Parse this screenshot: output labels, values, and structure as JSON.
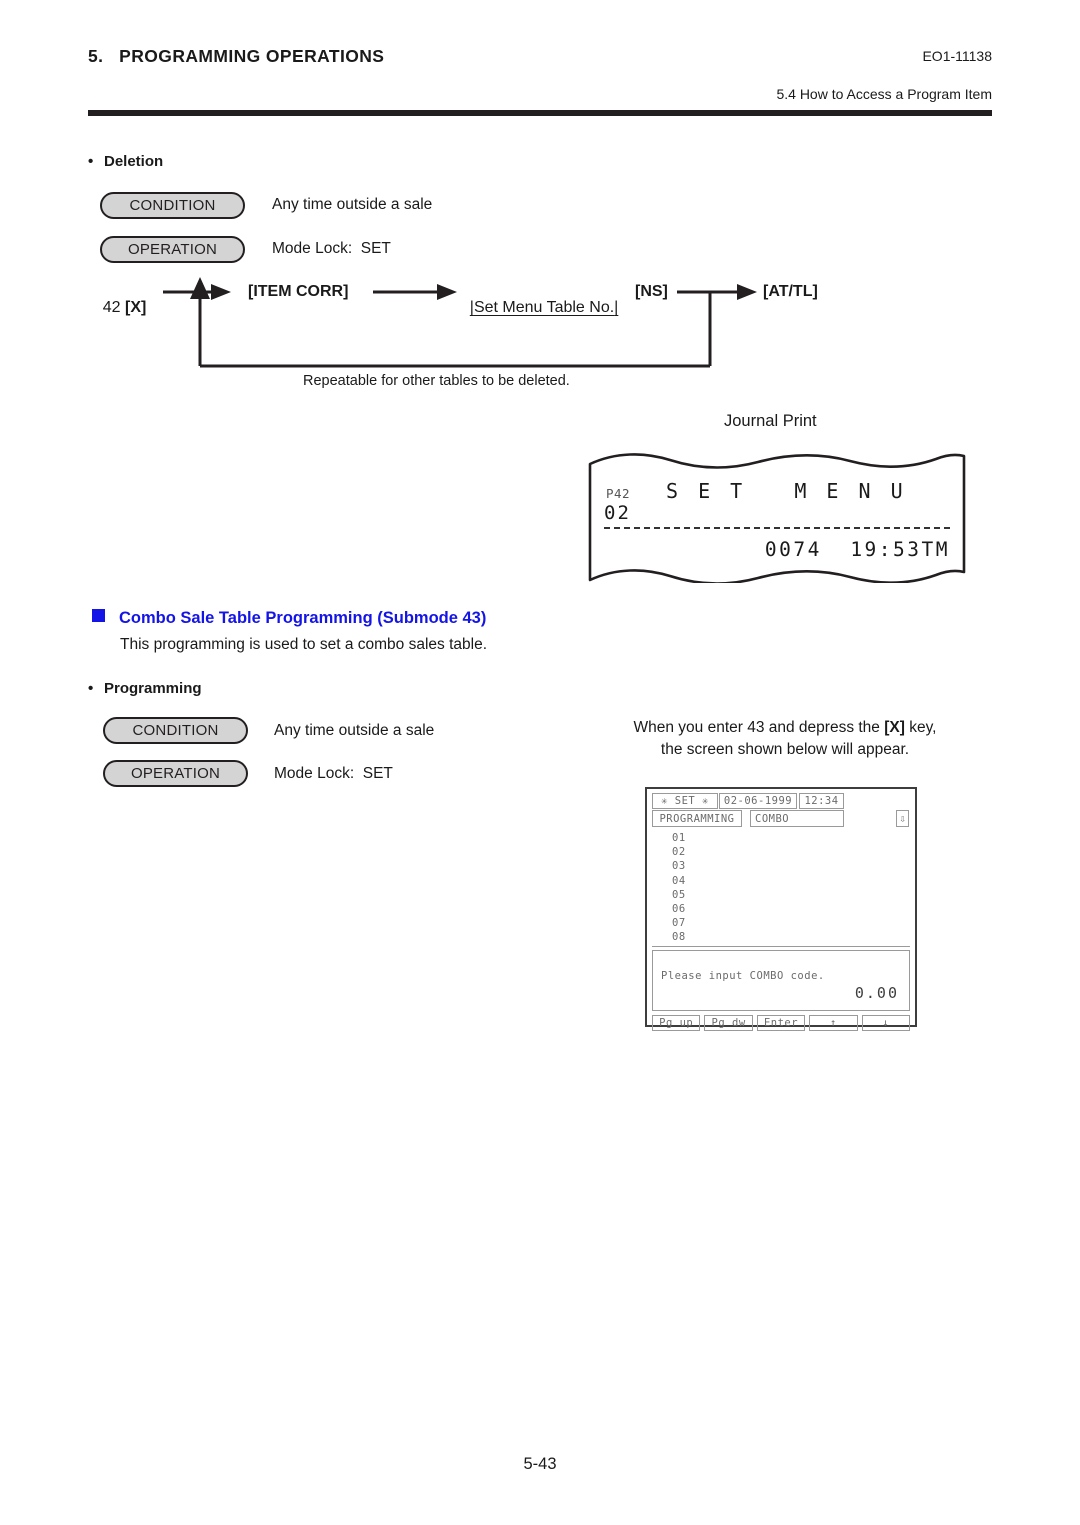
{
  "header": {
    "chapter": "5.   PROGRAMMING OPERATIONS",
    "doc_code": "EO1-11138",
    "section": "5.4  How to Access a Program Item"
  },
  "deletion": {
    "bullet": "•",
    "title": "Deletion",
    "condition_label": "CONDITION",
    "condition_text": "Any time outside a sale",
    "operation_label": "OPERATION",
    "operation_text": "Mode Lock:  SET",
    "flow": {
      "step1_plain": "42 ",
      "step1_bold": "[X]",
      "step2": "[ITEM CORR]",
      "step3_bar_open": "|",
      "step3_text": "Set Menu Table No.",
      "step3_bar_close": "|",
      "step4": "[NS]",
      "step5": "[AT/TL]",
      "loop_caption": "Repeatable for other tables to be deleted."
    }
  },
  "journal": {
    "title": "Journal Print",
    "code": "P42",
    "name": "S E T   M E N U",
    "number": "02",
    "total": "0074  19:53TM"
  },
  "combo_section": {
    "heading": "Combo Sale Table Programming (Submode 43)",
    "heading_color": "#1414e6",
    "description": "This programming is used to set a combo sales table.",
    "bullet": "•",
    "sub_title": "Programming",
    "condition_label": "CONDITION",
    "condition_text": "Any time outside a sale",
    "operation_label": "OPERATION",
    "operation_text": "Mode Lock:  SET",
    "note_line1_a": "When you enter 43 and depress the ",
    "note_line1_b": "[X]",
    "note_line1_c": " key,",
    "note_line2": "the screen shown below will appear."
  },
  "lcd": {
    "mode": "✳ SET ✳",
    "date": "02-06-1999",
    "time": "12:34",
    "programming_label": "PROGRAMMING",
    "combo_label": "COMBO",
    "scroll_icon": "⇩",
    "list": [
      "01",
      "02",
      "03",
      "04",
      "05",
      "06",
      "07",
      "08"
    ],
    "message": "Please input COMBO code.",
    "amount": "0.00",
    "keys": [
      "Pg up",
      "Pg dw",
      "Enter",
      "↑",
      "↓"
    ]
  },
  "footer": {
    "page_number": "5-43"
  }
}
